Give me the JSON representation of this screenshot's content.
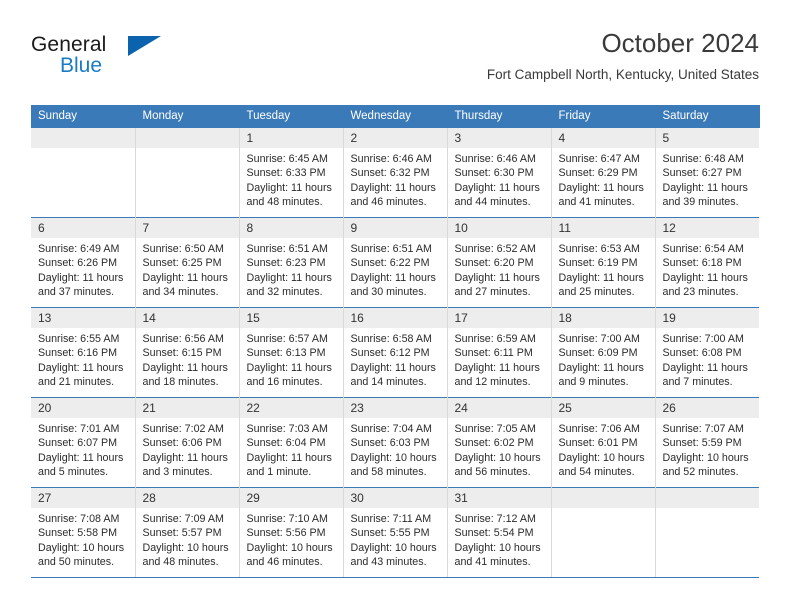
{
  "brand": {
    "name_top": "General",
    "name_bottom": "Blue",
    "accent_color": "#0b63ad",
    "blue_text_color": "#1a7cc6"
  },
  "header": {
    "title": "October 2024",
    "subtitle": "Fort Campbell North, Kentucky, United States"
  },
  "theme": {
    "header_blue": "#3b7ab8",
    "daynum_band": "#ededed",
    "cell_border": "#d9d9d9",
    "text": "#2b2b2b"
  },
  "weekdays": [
    "Sunday",
    "Monday",
    "Tuesday",
    "Wednesday",
    "Thursday",
    "Friday",
    "Saturday"
  ],
  "weeks": [
    [
      {
        "day": "",
        "sunrise": "",
        "sunset": "",
        "daylight1": "",
        "daylight2": ""
      },
      {
        "day": "",
        "sunrise": "",
        "sunset": "",
        "daylight1": "",
        "daylight2": ""
      },
      {
        "day": "1",
        "sunrise": "Sunrise: 6:45 AM",
        "sunset": "Sunset: 6:33 PM",
        "daylight1": "Daylight: 11 hours",
        "daylight2": "and 48 minutes."
      },
      {
        "day": "2",
        "sunrise": "Sunrise: 6:46 AM",
        "sunset": "Sunset: 6:32 PM",
        "daylight1": "Daylight: 11 hours",
        "daylight2": "and 46 minutes."
      },
      {
        "day": "3",
        "sunrise": "Sunrise: 6:46 AM",
        "sunset": "Sunset: 6:30 PM",
        "daylight1": "Daylight: 11 hours",
        "daylight2": "and 44 minutes."
      },
      {
        "day": "4",
        "sunrise": "Sunrise: 6:47 AM",
        "sunset": "Sunset: 6:29 PM",
        "daylight1": "Daylight: 11 hours",
        "daylight2": "and 41 minutes."
      },
      {
        "day": "5",
        "sunrise": "Sunrise: 6:48 AM",
        "sunset": "Sunset: 6:27 PM",
        "daylight1": "Daylight: 11 hours",
        "daylight2": "and 39 minutes."
      }
    ],
    [
      {
        "day": "6",
        "sunrise": "Sunrise: 6:49 AM",
        "sunset": "Sunset: 6:26 PM",
        "daylight1": "Daylight: 11 hours",
        "daylight2": "and 37 minutes."
      },
      {
        "day": "7",
        "sunrise": "Sunrise: 6:50 AM",
        "sunset": "Sunset: 6:25 PM",
        "daylight1": "Daylight: 11 hours",
        "daylight2": "and 34 minutes."
      },
      {
        "day": "8",
        "sunrise": "Sunrise: 6:51 AM",
        "sunset": "Sunset: 6:23 PM",
        "daylight1": "Daylight: 11 hours",
        "daylight2": "and 32 minutes."
      },
      {
        "day": "9",
        "sunrise": "Sunrise: 6:51 AM",
        "sunset": "Sunset: 6:22 PM",
        "daylight1": "Daylight: 11 hours",
        "daylight2": "and 30 minutes."
      },
      {
        "day": "10",
        "sunrise": "Sunrise: 6:52 AM",
        "sunset": "Sunset: 6:20 PM",
        "daylight1": "Daylight: 11 hours",
        "daylight2": "and 27 minutes."
      },
      {
        "day": "11",
        "sunrise": "Sunrise: 6:53 AM",
        "sunset": "Sunset: 6:19 PM",
        "daylight1": "Daylight: 11 hours",
        "daylight2": "and 25 minutes."
      },
      {
        "day": "12",
        "sunrise": "Sunrise: 6:54 AM",
        "sunset": "Sunset: 6:18 PM",
        "daylight1": "Daylight: 11 hours",
        "daylight2": "and 23 minutes."
      }
    ],
    [
      {
        "day": "13",
        "sunrise": "Sunrise: 6:55 AM",
        "sunset": "Sunset: 6:16 PM",
        "daylight1": "Daylight: 11 hours",
        "daylight2": "and 21 minutes."
      },
      {
        "day": "14",
        "sunrise": "Sunrise: 6:56 AM",
        "sunset": "Sunset: 6:15 PM",
        "daylight1": "Daylight: 11 hours",
        "daylight2": "and 18 minutes."
      },
      {
        "day": "15",
        "sunrise": "Sunrise: 6:57 AM",
        "sunset": "Sunset: 6:13 PM",
        "daylight1": "Daylight: 11 hours",
        "daylight2": "and 16 minutes."
      },
      {
        "day": "16",
        "sunrise": "Sunrise: 6:58 AM",
        "sunset": "Sunset: 6:12 PM",
        "daylight1": "Daylight: 11 hours",
        "daylight2": "and 14 minutes."
      },
      {
        "day": "17",
        "sunrise": "Sunrise: 6:59 AM",
        "sunset": "Sunset: 6:11 PM",
        "daylight1": "Daylight: 11 hours",
        "daylight2": "and 12 minutes."
      },
      {
        "day": "18",
        "sunrise": "Sunrise: 7:00 AM",
        "sunset": "Sunset: 6:09 PM",
        "daylight1": "Daylight: 11 hours",
        "daylight2": "and 9 minutes."
      },
      {
        "day": "19",
        "sunrise": "Sunrise: 7:00 AM",
        "sunset": "Sunset: 6:08 PM",
        "daylight1": "Daylight: 11 hours",
        "daylight2": "and 7 minutes."
      }
    ],
    [
      {
        "day": "20",
        "sunrise": "Sunrise: 7:01 AM",
        "sunset": "Sunset: 6:07 PM",
        "daylight1": "Daylight: 11 hours",
        "daylight2": "and 5 minutes."
      },
      {
        "day": "21",
        "sunrise": "Sunrise: 7:02 AM",
        "sunset": "Sunset: 6:06 PM",
        "daylight1": "Daylight: 11 hours",
        "daylight2": "and 3 minutes."
      },
      {
        "day": "22",
        "sunrise": "Sunrise: 7:03 AM",
        "sunset": "Sunset: 6:04 PM",
        "daylight1": "Daylight: 11 hours",
        "daylight2": "and 1 minute."
      },
      {
        "day": "23",
        "sunrise": "Sunrise: 7:04 AM",
        "sunset": "Sunset: 6:03 PM",
        "daylight1": "Daylight: 10 hours",
        "daylight2": "and 58 minutes."
      },
      {
        "day": "24",
        "sunrise": "Sunrise: 7:05 AM",
        "sunset": "Sunset: 6:02 PM",
        "daylight1": "Daylight: 10 hours",
        "daylight2": "and 56 minutes."
      },
      {
        "day": "25",
        "sunrise": "Sunrise: 7:06 AM",
        "sunset": "Sunset: 6:01 PM",
        "daylight1": "Daylight: 10 hours",
        "daylight2": "and 54 minutes."
      },
      {
        "day": "26",
        "sunrise": "Sunrise: 7:07 AM",
        "sunset": "Sunset: 5:59 PM",
        "daylight1": "Daylight: 10 hours",
        "daylight2": "and 52 minutes."
      }
    ],
    [
      {
        "day": "27",
        "sunrise": "Sunrise: 7:08 AM",
        "sunset": "Sunset: 5:58 PM",
        "daylight1": "Daylight: 10 hours",
        "daylight2": "and 50 minutes."
      },
      {
        "day": "28",
        "sunrise": "Sunrise: 7:09 AM",
        "sunset": "Sunset: 5:57 PM",
        "daylight1": "Daylight: 10 hours",
        "daylight2": "and 48 minutes."
      },
      {
        "day": "29",
        "sunrise": "Sunrise: 7:10 AM",
        "sunset": "Sunset: 5:56 PM",
        "daylight1": "Daylight: 10 hours",
        "daylight2": "and 46 minutes."
      },
      {
        "day": "30",
        "sunrise": "Sunrise: 7:11 AM",
        "sunset": "Sunset: 5:55 PM",
        "daylight1": "Daylight: 10 hours",
        "daylight2": "and 43 minutes."
      },
      {
        "day": "31",
        "sunrise": "Sunrise: 7:12 AM",
        "sunset": "Sunset: 5:54 PM",
        "daylight1": "Daylight: 10 hours",
        "daylight2": "and 41 minutes."
      },
      {
        "day": "",
        "sunrise": "",
        "sunset": "",
        "daylight1": "",
        "daylight2": ""
      },
      {
        "day": "",
        "sunrise": "",
        "sunset": "",
        "daylight1": "",
        "daylight2": ""
      }
    ]
  ]
}
